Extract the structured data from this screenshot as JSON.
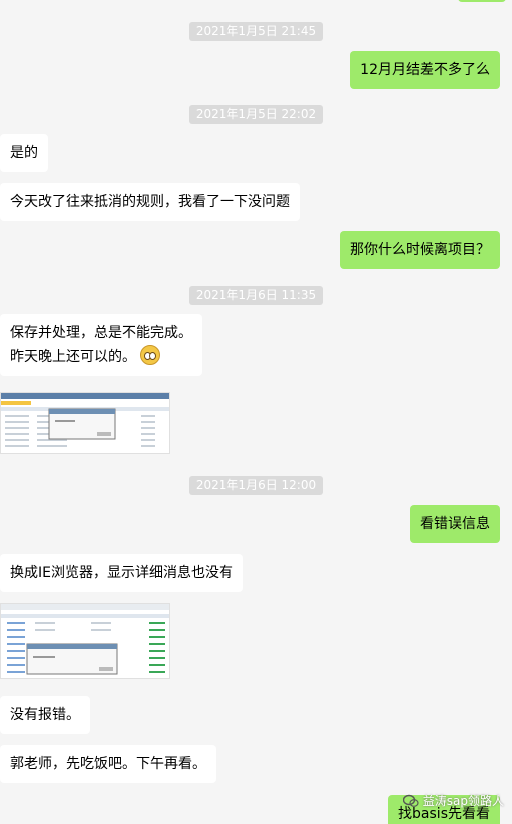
{
  "timestamps": [
    "2021年1月5日 21:45",
    "2021年1月5日 22:02",
    "2021年1月6日 11:35",
    "2021年1月6日 12:00"
  ],
  "messages": [
    {
      "side": "right",
      "text": "12月月结差不多了么"
    },
    {
      "side": "left",
      "text": "是的"
    },
    {
      "side": "left",
      "text": "今天改了往来抵消的规则，我看了一下没问题"
    },
    {
      "side": "right",
      "text": "那你什么时候离项目？"
    },
    {
      "side": "left",
      "line1": "保存并处理，总是不能完成。",
      "line2": "昨天晚上还可以的。",
      "emoji": "blush-emoji"
    },
    {
      "side": "left",
      "type": "image",
      "desc": "screenshot-thumbnail"
    },
    {
      "side": "right",
      "text": "看错误信息"
    },
    {
      "side": "left",
      "text": "换成IE浏览器，显示详细消息也没有"
    },
    {
      "side": "left",
      "type": "image",
      "desc": "screenshot-thumbnail"
    },
    {
      "side": "left",
      "text": "没有报错。"
    },
    {
      "side": "left",
      "text": "郭老师，先吃饭吧。下午再看。"
    },
    {
      "side": "right",
      "text": "找basis先看看"
    }
  ],
  "watermark": {
    "text": "益涛sap领路人"
  },
  "colors": {
    "background": "#f5f5f5",
    "right_bubble": "#9eea6a",
    "left_bubble": "#ffffff",
    "timestamp_bg": "#dadada"
  }
}
